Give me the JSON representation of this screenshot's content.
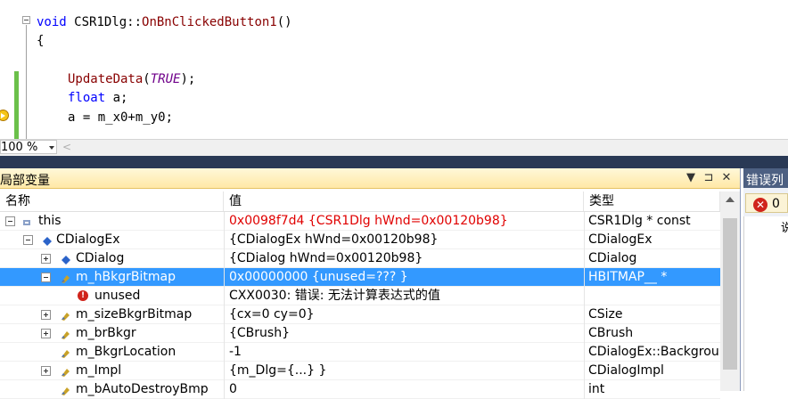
{
  "editor": {
    "lines": [
      {
        "parts": [
          {
            "cls": "kw",
            "text": "void "
          },
          {
            "cls": "plain",
            "text": "CSR1Dlg::"
          },
          {
            "cls": "fn",
            "text": "OnBnClickedButton1"
          },
          {
            "cls": "plain",
            "text": "()"
          }
        ]
      },
      {
        "parts": [
          {
            "cls": "plain",
            "text": "{"
          }
        ]
      },
      {
        "parts": []
      },
      {
        "parts": [
          {
            "cls": "fn",
            "text": "UpdateData"
          },
          {
            "cls": "plain",
            "text": "("
          },
          {
            "cls": "mac",
            "text": "TRUE"
          },
          {
            "cls": "plain",
            "text": ");"
          }
        ]
      },
      {
        "parts": [
          {
            "cls": "kw",
            "text": "float "
          },
          {
            "cls": "plain",
            "text": "a;"
          }
        ]
      },
      {
        "parts": [
          {
            "cls": "plain",
            "text": "a = m_x0+m_y0;"
          }
        ]
      }
    ],
    "zoom": "100 %"
  },
  "locals": {
    "title": "局部变量",
    "buttons": {
      "dropdown": "▼",
      "pin": "⊐",
      "close": "✕"
    },
    "columns": {
      "name": "名称",
      "value": "值",
      "type": "类型"
    },
    "rows": [
      {
        "name": "this",
        "value": "0x0098f7d4 {CSR1Dlg hWnd=0x00120b98}",
        "type": "CSR1Dlg * const"
      },
      {
        "name": "CDialogEx",
        "value": "{CDialogEx hWnd=0x00120b98}",
        "type": "CDialogEx"
      },
      {
        "name": "CDialog",
        "value": "{CDialog hWnd=0x00120b98}",
        "type": "CDialog"
      },
      {
        "name": "m_hBkgrBitmap",
        "value": "0x00000000 {unused=??? }",
        "type": "HBITMAP__ *"
      },
      {
        "name": "unused",
        "value": "CXX0030: 错误: 无法计算表达式的值",
        "type": ""
      },
      {
        "name": "m_sizeBkgrBitmap",
        "value": "{cx=0 cy=0}",
        "type": "CSize"
      },
      {
        "name": "m_brBkgr",
        "value": "{CBrush}",
        "type": "CBrush"
      },
      {
        "name": "m_BkgrLocation",
        "value": "-1",
        "type": "CDialogEx::Backgrour"
      },
      {
        "name": "m_Impl",
        "value": "{m_Dlg={...} }",
        "type": "CDialogImpl"
      },
      {
        "name": "m_bAutoDestroyBmp",
        "value": "0",
        "type": "int"
      }
    ]
  },
  "errors": {
    "title": "错误列",
    "count": "0",
    "column": "说"
  },
  "colors": {
    "selection": "#3399ff",
    "error_value": "#e00000",
    "panel_title_active": "#ffe8a6",
    "dark_band": "#293955"
  }
}
